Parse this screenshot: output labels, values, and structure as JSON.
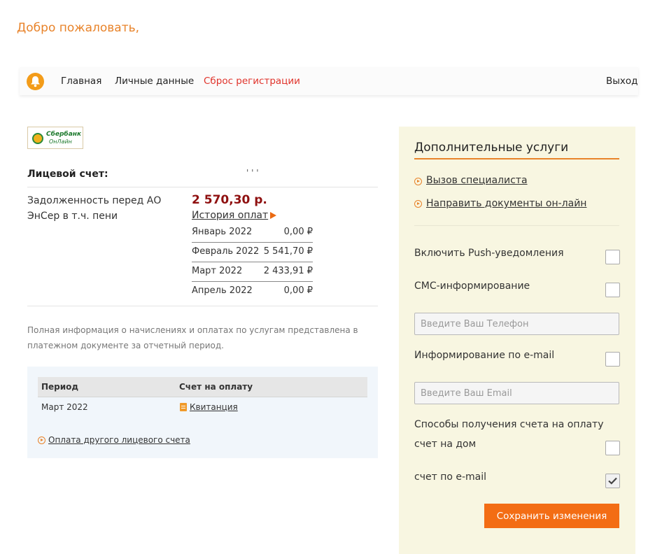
{
  "header": {
    "welcome": "Добро пожаловать,"
  },
  "nav": {
    "home": "Главная",
    "personal": "Личные данные",
    "reset": "Сброс регистрации",
    "logout": "Выход"
  },
  "logo": {
    "line1": "Сбербанк",
    "line2": "ОнЛайн"
  },
  "account": {
    "label": "Лицевой счет:",
    "number": "' ' '",
    "debt_label": "Задолженность перед АО ЭнСер в т.ч. пени",
    "debt_amount": "2 570,30 р.",
    "history_link": "История оплат",
    "payments": [
      {
        "month": "Январь 2022",
        "amount": "0,00 ₽"
      },
      {
        "month": "Февраль 2022",
        "amount": "5 541,70 ₽"
      },
      {
        "month": "Март 2022",
        "amount": "2 433,91 ₽"
      },
      {
        "month": "Апрель 2022",
        "amount": "0,00 ₽"
      }
    ]
  },
  "info_text": "Полная информация о начислениях и оплатах по услугам представлена в платежном документе за отчетный период.",
  "bills": {
    "col_period": "Период",
    "col_invoice": "Счет на оплату",
    "rows": [
      {
        "period": "Март 2022",
        "invoice": "Квитанция"
      }
    ],
    "other_account_link": "Оплата другого лицевого счета"
  },
  "sidebar": {
    "title": "Дополнительные услуги",
    "links": [
      "Вызов специалиста",
      "Направить документы он-лайн"
    ],
    "push_label": "Включить Push-уведомления",
    "push_checked": false,
    "sms_label": "СМС-информирование",
    "sms_checked": false,
    "phone_placeholder": "Введите Ваш Телефон",
    "email_label": "Информирование по e-mail",
    "email_checked": false,
    "email_placeholder": "Введите Ваш Email",
    "delivery_title": "Способы получения счета на оплату",
    "home_label": "счет на дом",
    "home_checked": false,
    "email_bill_label": "счет по e-mail",
    "email_bill_checked": true,
    "save_button": "Сохранить изменения"
  },
  "colors": {
    "accent": "#e8832a",
    "button": "#f36d14",
    "debt": "#8f1010",
    "reset_link": "#e0332b",
    "sidebar_bg": "#f8f6e1"
  }
}
